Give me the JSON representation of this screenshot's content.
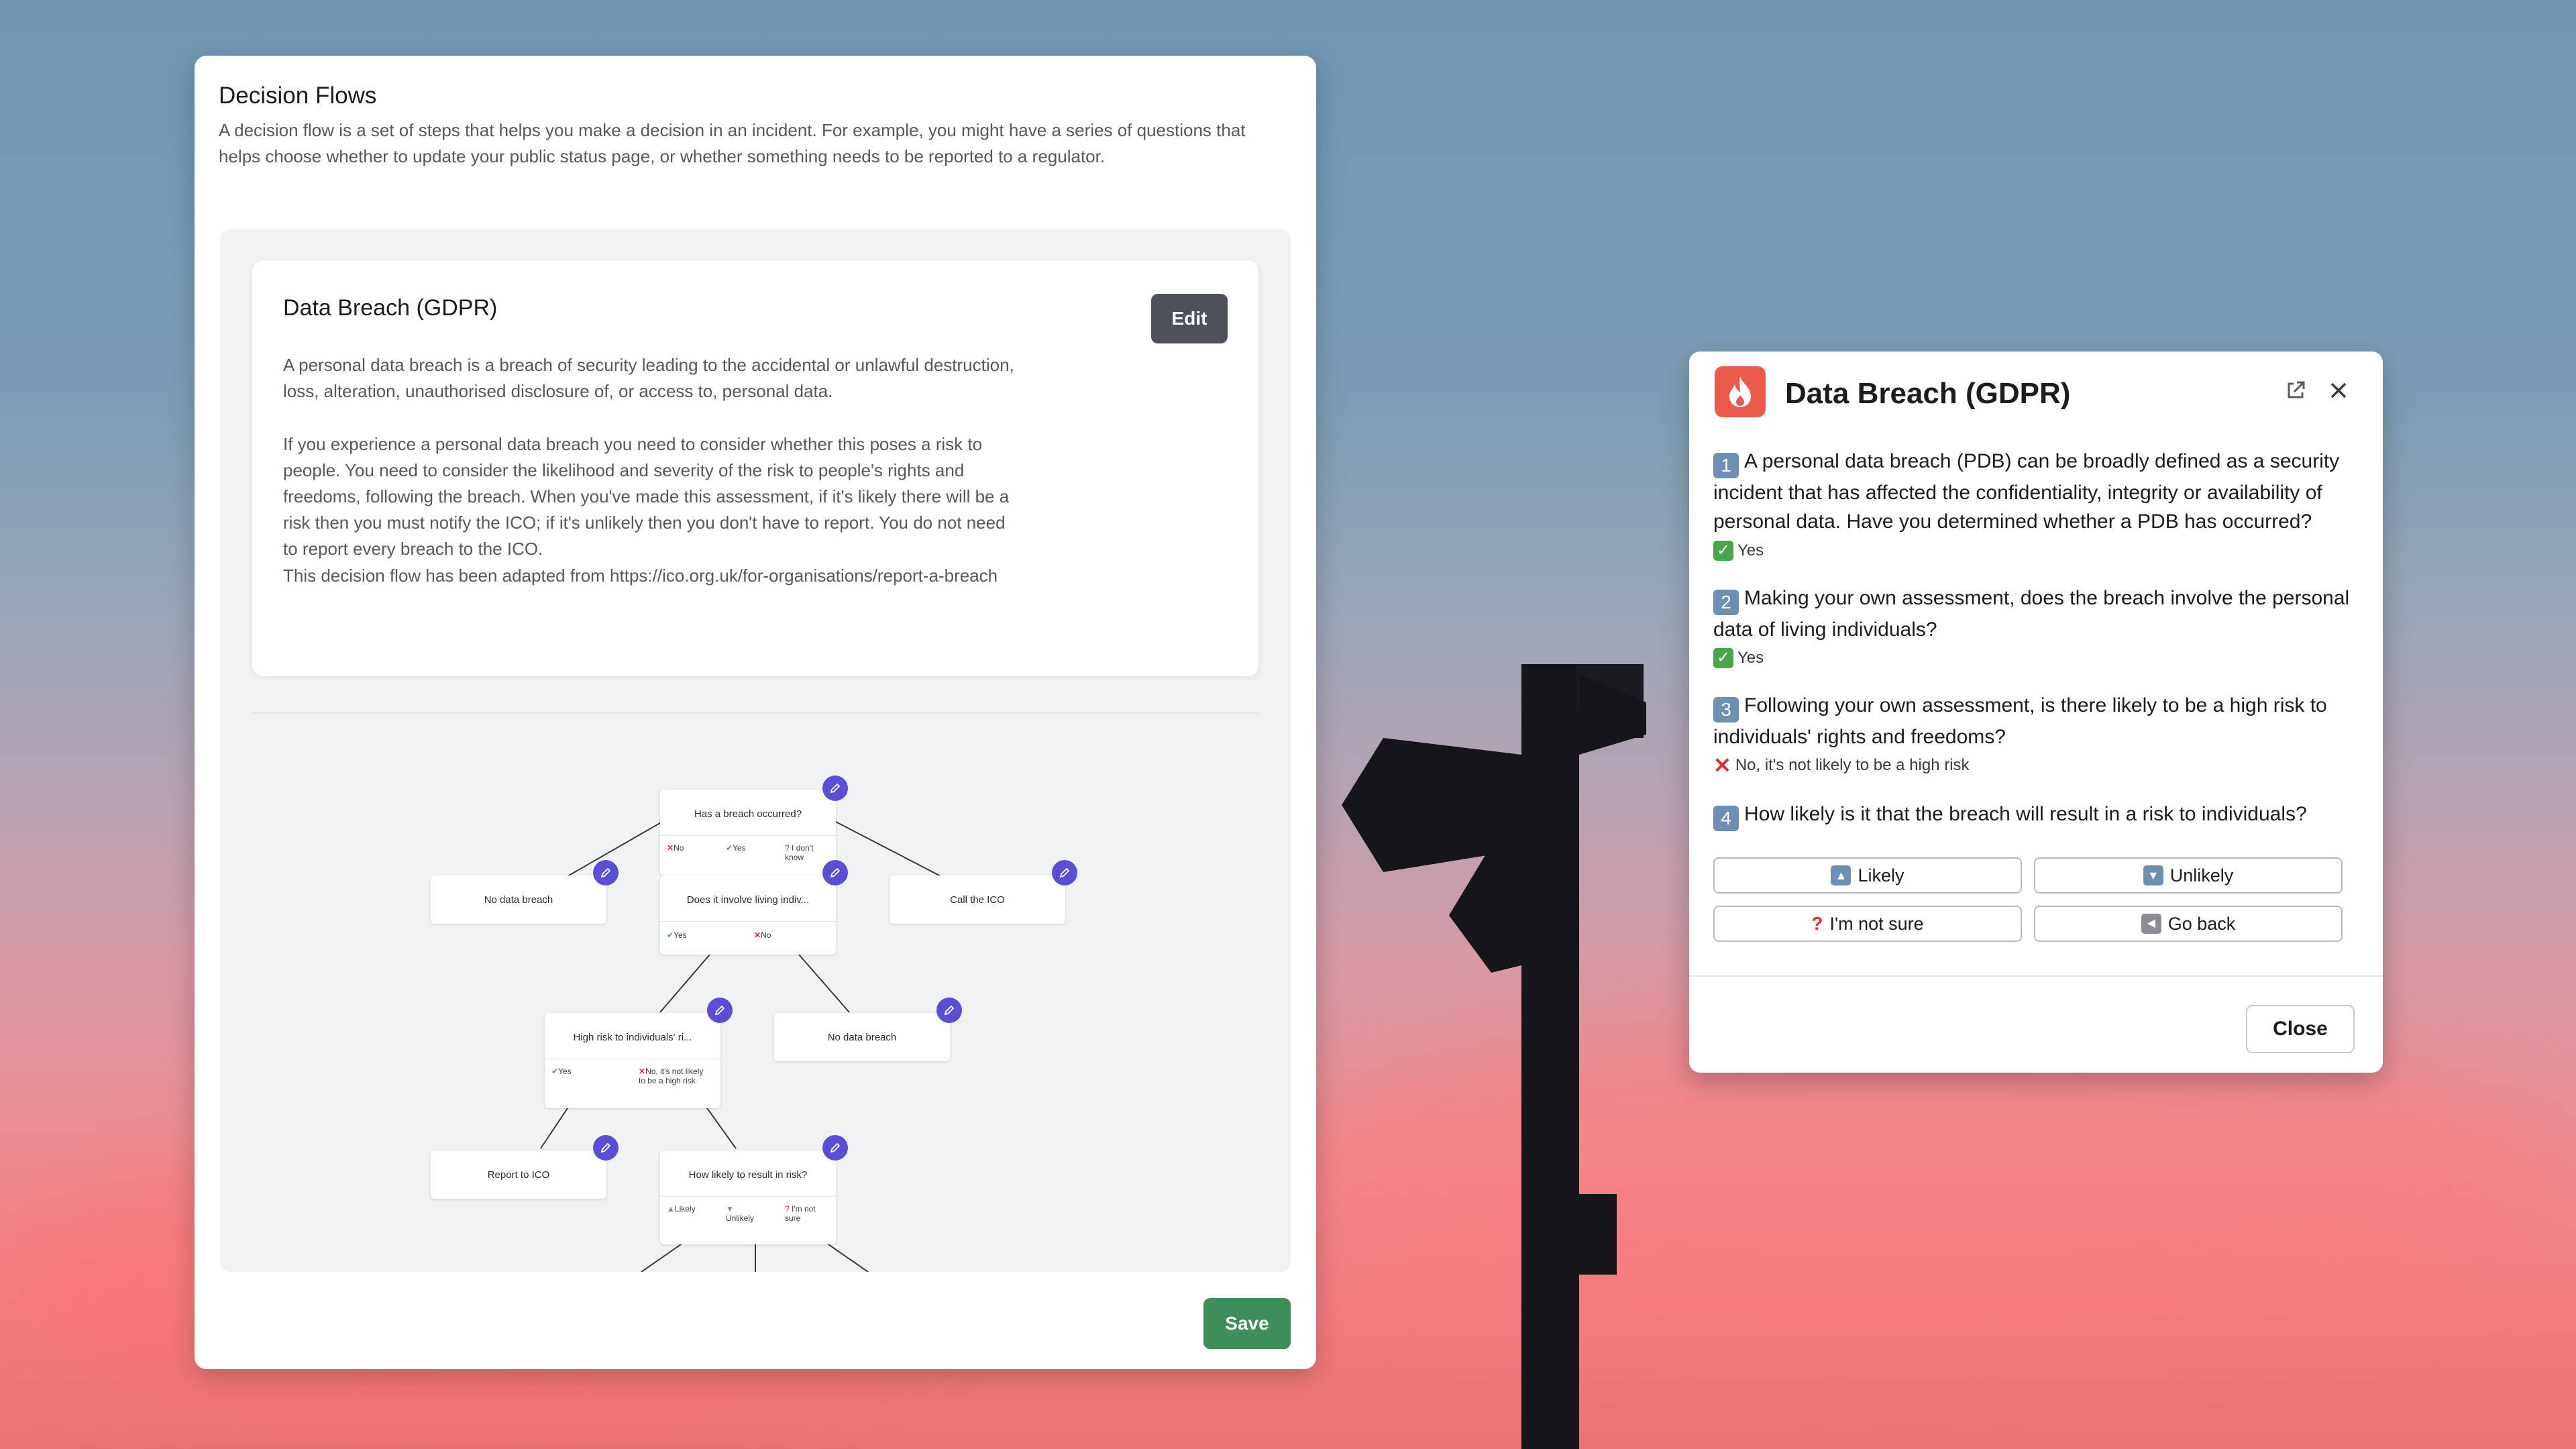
{
  "decision_flows": {
    "title": "Decision Flows",
    "description": "A decision flow is a set of steps that helps you make a decision in an incident. For example, you might have a series of questions that helps choose whether to update your public status page, or whether something needs to be reported to a regulator.",
    "card": {
      "title": "Data Breach (GDPR)",
      "edit_label": "Edit",
      "paragraphs": [
        "A personal data breach is a breach of security leading to the accidental or unlawful destruction, loss, alteration, unauthorised disclosure of, or access to, personal data.",
        "If you experience a personal data breach you need to consider whether this poses a risk to people. You need to consider the likelihood and severity of the risk to people's rights and freedoms, following the breach. When you've made this assessment, if it's likely there will be a risk then you must notify the ICO; if it's unlikely then you don't have to report. You do not need to report every breach to the ICO.",
        "This decision flow has been adapted from https://ico.org.uk/for-organisations/report-a-breach"
      ]
    },
    "flow": {
      "nodes": {
        "n1": {
          "title": "Has a breach occurred?",
          "options": [
            "No",
            "Yes",
            "I don't know"
          ]
        },
        "n2": {
          "title": "No data breach"
        },
        "n3": {
          "title": "Does it involve living indiv...",
          "options": [
            "Yes",
            "No"
          ]
        },
        "n4": {
          "title": "Call the ICO"
        },
        "n5": {
          "title": "High risk to individuals' ri...",
          "options": [
            "Yes",
            "No, it's not likely to be a high risk"
          ]
        },
        "n6": {
          "title": "No data breach"
        },
        "n7": {
          "title": "Report to ICO"
        },
        "n8": {
          "title": "How likely to result in risk?",
          "options": [
            "Likely",
            "Unlikely",
            "I'm not sure"
          ]
        }
      },
      "icons": {
        "edit": "pencil-icon"
      }
    },
    "save_label": "Save"
  },
  "modal": {
    "title": "Data Breach (GDPR)",
    "icons": {
      "app": "flame-icon",
      "open_external": "external-link-icon",
      "close": "close-icon"
    },
    "questions": [
      {
        "number": "1",
        "text": "A personal data breach (PDB) can be broadly defined as a security incident that has affected the confidentiality, integrity or availability of personal data. Have you determined whether a PDB has occurred?",
        "answer": "Yes",
        "answer_type": "check"
      },
      {
        "number": "2",
        "text": "Making your own assessment, does the breach involve the personal data of living individuals?",
        "answer": "Yes",
        "answer_type": "check"
      },
      {
        "number": "3",
        "text": "Following your own assessment, is there likely to be a high risk to individuals' rights and freedoms?",
        "answer": "No, it's not likely to be a high risk",
        "answer_type": "cross"
      },
      {
        "number": "4",
        "text": "How likely is it that the breach will result in a risk to individuals?"
      }
    ],
    "choices": {
      "likely": "Likely",
      "unlikely": "Unlikely",
      "not_sure": "I'm not sure",
      "go_back": "Go back"
    },
    "close_label": "Close"
  },
  "colors": {
    "accent_purple": "#5a4ed6",
    "save_green": "#3e8e5a",
    "edit_dark": "#4c5058",
    "app_icon_red": "#ea5b4b"
  }
}
